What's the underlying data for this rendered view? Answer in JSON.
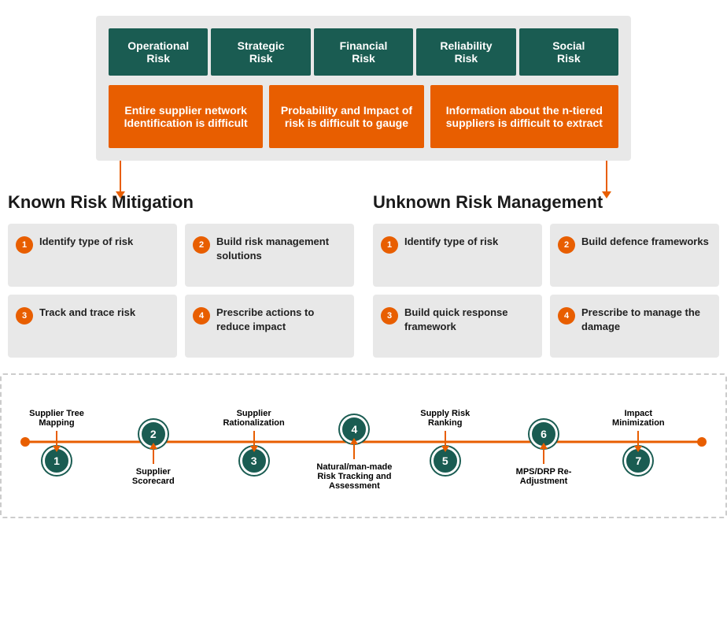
{
  "riskHeaders": [
    "Operational Risk",
    "Strategic Risk",
    "Financial Risk",
    "Reliability Risk",
    "Social Risk"
  ],
  "riskBoxes": [
    {
      "text": "Entire supplier network Identification is difficult",
      "class": "risk-box-wide"
    },
    {
      "text": "Probability and Impact of risk is difficult to gauge",
      "class": "risk-box-normal"
    },
    {
      "text": "Information about the n-tiered suppliers is difficult to extract",
      "class": "risk-box-wide2"
    }
  ],
  "knownPanel": {
    "title": "Known Risk Mitigation",
    "items": [
      {
        "num": "1",
        "text": "Identify type of risk"
      },
      {
        "num": "2",
        "text": "Build risk management solutions"
      },
      {
        "num": "3",
        "text": "Track and trace risk"
      },
      {
        "num": "4",
        "text": "Prescribe actions to reduce impact"
      }
    ]
  },
  "unknownPanel": {
    "title": "Unknown Risk Management",
    "items": [
      {
        "num": "1",
        "text": "Identify type of risk"
      },
      {
        "num": "2",
        "text": "Build defence frameworks"
      },
      {
        "num": "3",
        "text": "Build quick response framework"
      },
      {
        "num": "4",
        "text": "Prescribe to manage the damage"
      }
    ]
  },
  "timeline": {
    "nodes": [
      {
        "num": "1",
        "labelAbove": "Supplier Tree Mapping",
        "labelBelow": "",
        "side": "above"
      },
      {
        "num": "2",
        "labelAbove": "",
        "labelBelow": "Supplier Scorecard",
        "side": "below"
      },
      {
        "num": "3",
        "labelAbove": "Supplier Rationalization",
        "labelBelow": "",
        "side": "above"
      },
      {
        "num": "4",
        "labelAbove": "",
        "labelBelow": "Natural/man-made Risk Tracking and Assessment",
        "side": "below"
      },
      {
        "num": "5",
        "labelAbove": "Supply Risk Ranking",
        "labelBelow": "",
        "side": "above"
      },
      {
        "num": "6",
        "labelAbove": "",
        "labelBelow": "MPS/DRP Re-Adjustment",
        "side": "below"
      },
      {
        "num": "7",
        "labelAbove": "Impact Minimization",
        "labelBelow": "",
        "side": "above"
      }
    ]
  }
}
